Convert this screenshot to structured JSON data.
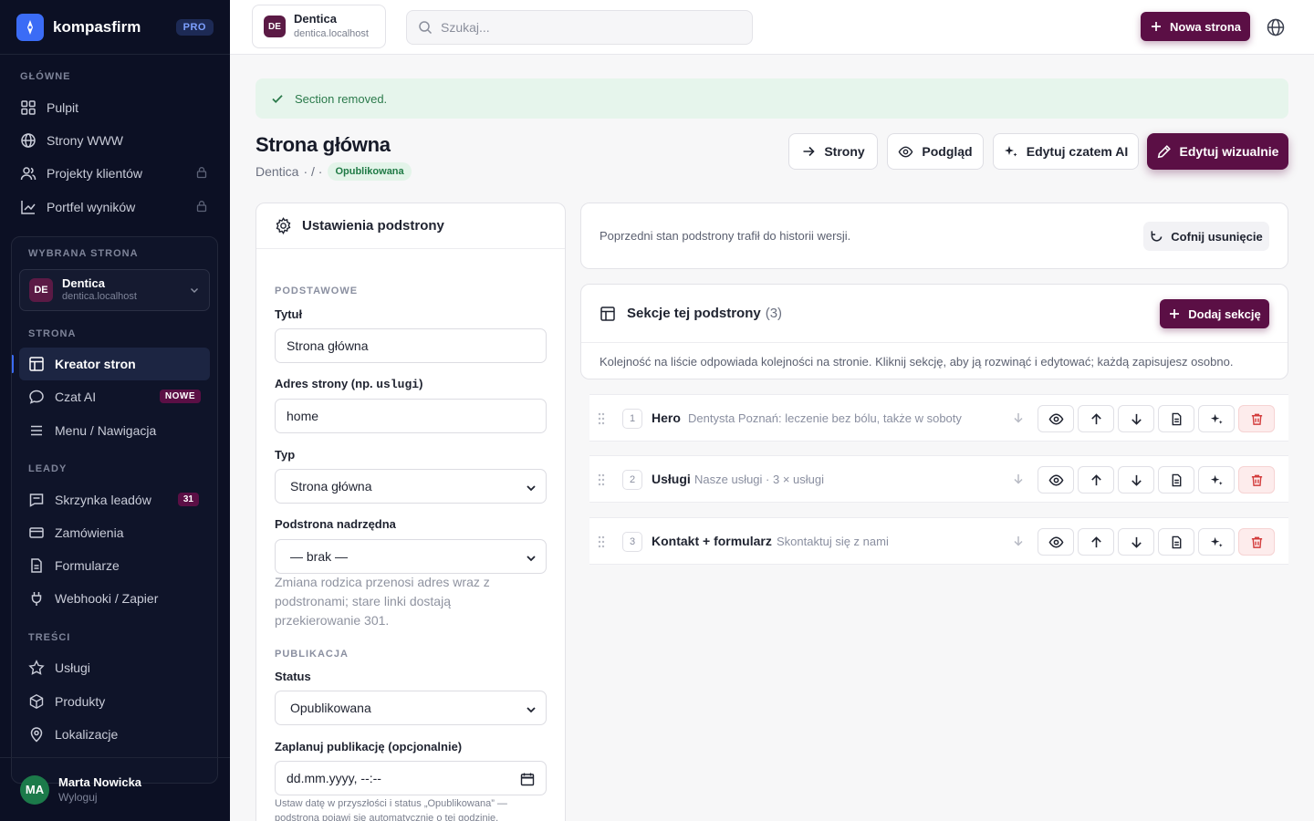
{
  "brand": {
    "name": "kompasfirm",
    "plan": "PRO"
  },
  "sidebar": {
    "main_label": "GŁÓWNE",
    "main_items": [
      {
        "label": "Pulpit",
        "icon": "grid-icon",
        "locked": false
      },
      {
        "label": "Strony WWW",
        "icon": "globe-icon",
        "locked": false
      },
      {
        "label": "Projekty klientów",
        "icon": "users-icon",
        "locked": true
      },
      {
        "label": "Portfel wyników",
        "icon": "chart-icon",
        "locked": true
      }
    ],
    "selected_label": "WYBRANA STRONA",
    "site": {
      "initials": "DE",
      "name": "Dentica",
      "domain": "dentica.localhost"
    },
    "strona_label": "STRONA",
    "strona_items": [
      {
        "label": "Kreator stron",
        "icon": "layout-icon",
        "active": true
      },
      {
        "label": "Czat AI",
        "icon": "chat-icon",
        "badge": "NOWE"
      },
      {
        "label": "Menu / Nawigacja",
        "icon": "menu-icon"
      }
    ],
    "leady_label": "LEADY",
    "leady_items": [
      {
        "label": "Skrzynka leadów",
        "icon": "inbox-icon",
        "badge": "31"
      },
      {
        "label": "Zamówienia",
        "icon": "card-icon"
      },
      {
        "label": "Formularze",
        "icon": "form-icon"
      },
      {
        "label": "Webhooki / Zapier",
        "icon": "plug-icon"
      }
    ],
    "tresci_label": "TREŚCI",
    "tresci_items": [
      {
        "label": "Usługi",
        "icon": "star-icon"
      },
      {
        "label": "Produkty",
        "icon": "box-icon"
      },
      {
        "label": "Lokalizacje",
        "icon": "pin-icon"
      }
    ],
    "user": {
      "initials": "MA",
      "name": "Marta Nowicka",
      "logout": "Wyloguj"
    }
  },
  "topbar": {
    "site": {
      "initials": "DE",
      "name": "Dentica",
      "domain": "dentica.localhost"
    },
    "search_placeholder": "Szukaj...",
    "new_page": "Nowa strona"
  },
  "alert": "Section removed.",
  "page": {
    "title": "Strona główna",
    "crumb_site": "Dentica",
    "crumb_sep": "· / ·",
    "status_badge": "Opublikowana",
    "btn_pages": "Strony",
    "btn_preview": "Podgląd",
    "btn_ai": "Edytuj czatem AI",
    "btn_visual": "Edytuj wizualnie"
  },
  "settings": {
    "title": "Ustawienia podstrony",
    "basic_label": "PODSTAWOWE",
    "title_label": "Tytuł",
    "title_value": "Strona główna",
    "url_label_pre": "Adres strony (np. ",
    "url_label_code": "uslugi",
    "url_label_post": ")",
    "url_value": "home",
    "type_label": "Typ",
    "type_value": "Strona główna",
    "parent_label": "Podstrona nadrzędna",
    "parent_value": "— brak —",
    "parent_help": "Zmiana rodzica przenosi adres wraz z podstronami; stare linki dostają przekierowanie 301.",
    "pub_label": "PUBLIKACJA",
    "status_label": "Status",
    "status_value": "Opublikowana",
    "schedule_label": "Zaplanuj publikację (opcjonalnie)",
    "schedule_value": "dd.mm.yyyy, --:--",
    "schedule_help": "Ustaw datę w przyszłości i status „Opublikowana” — podstrona pojawi się automatycznie o tej godzinie."
  },
  "undo": {
    "text": "Poprzedni stan podstrony trafił do historii wersji.",
    "button": "Cofnij usunięcie"
  },
  "sections": {
    "title": "Sekcje tej podstrony",
    "count": "(3)",
    "add": "Dodaj sekcję",
    "desc": "Kolejność na liście odpowiada kolejności na stronie. Kliknij sekcję, aby ją rozwinąć i edytować; każdą zapisujesz osobno.",
    "rows": [
      {
        "num": "1",
        "title": "Hero",
        "subtitle": "Dentysta Poznań: leczenie bez bólu, także w soboty"
      },
      {
        "num": "2",
        "title": "Usługi",
        "subtitle": "Nasze usługi · 3 × usługi"
      },
      {
        "num": "3",
        "title": "Kontakt + formularz",
        "subtitle": "Skontaktuj się z nami"
      }
    ]
  },
  "colors": {
    "brand": "#5b0f45",
    "sidebar_bg": "#0c1024",
    "accent": "#3b6cf6",
    "success": "#2b7a4b"
  }
}
